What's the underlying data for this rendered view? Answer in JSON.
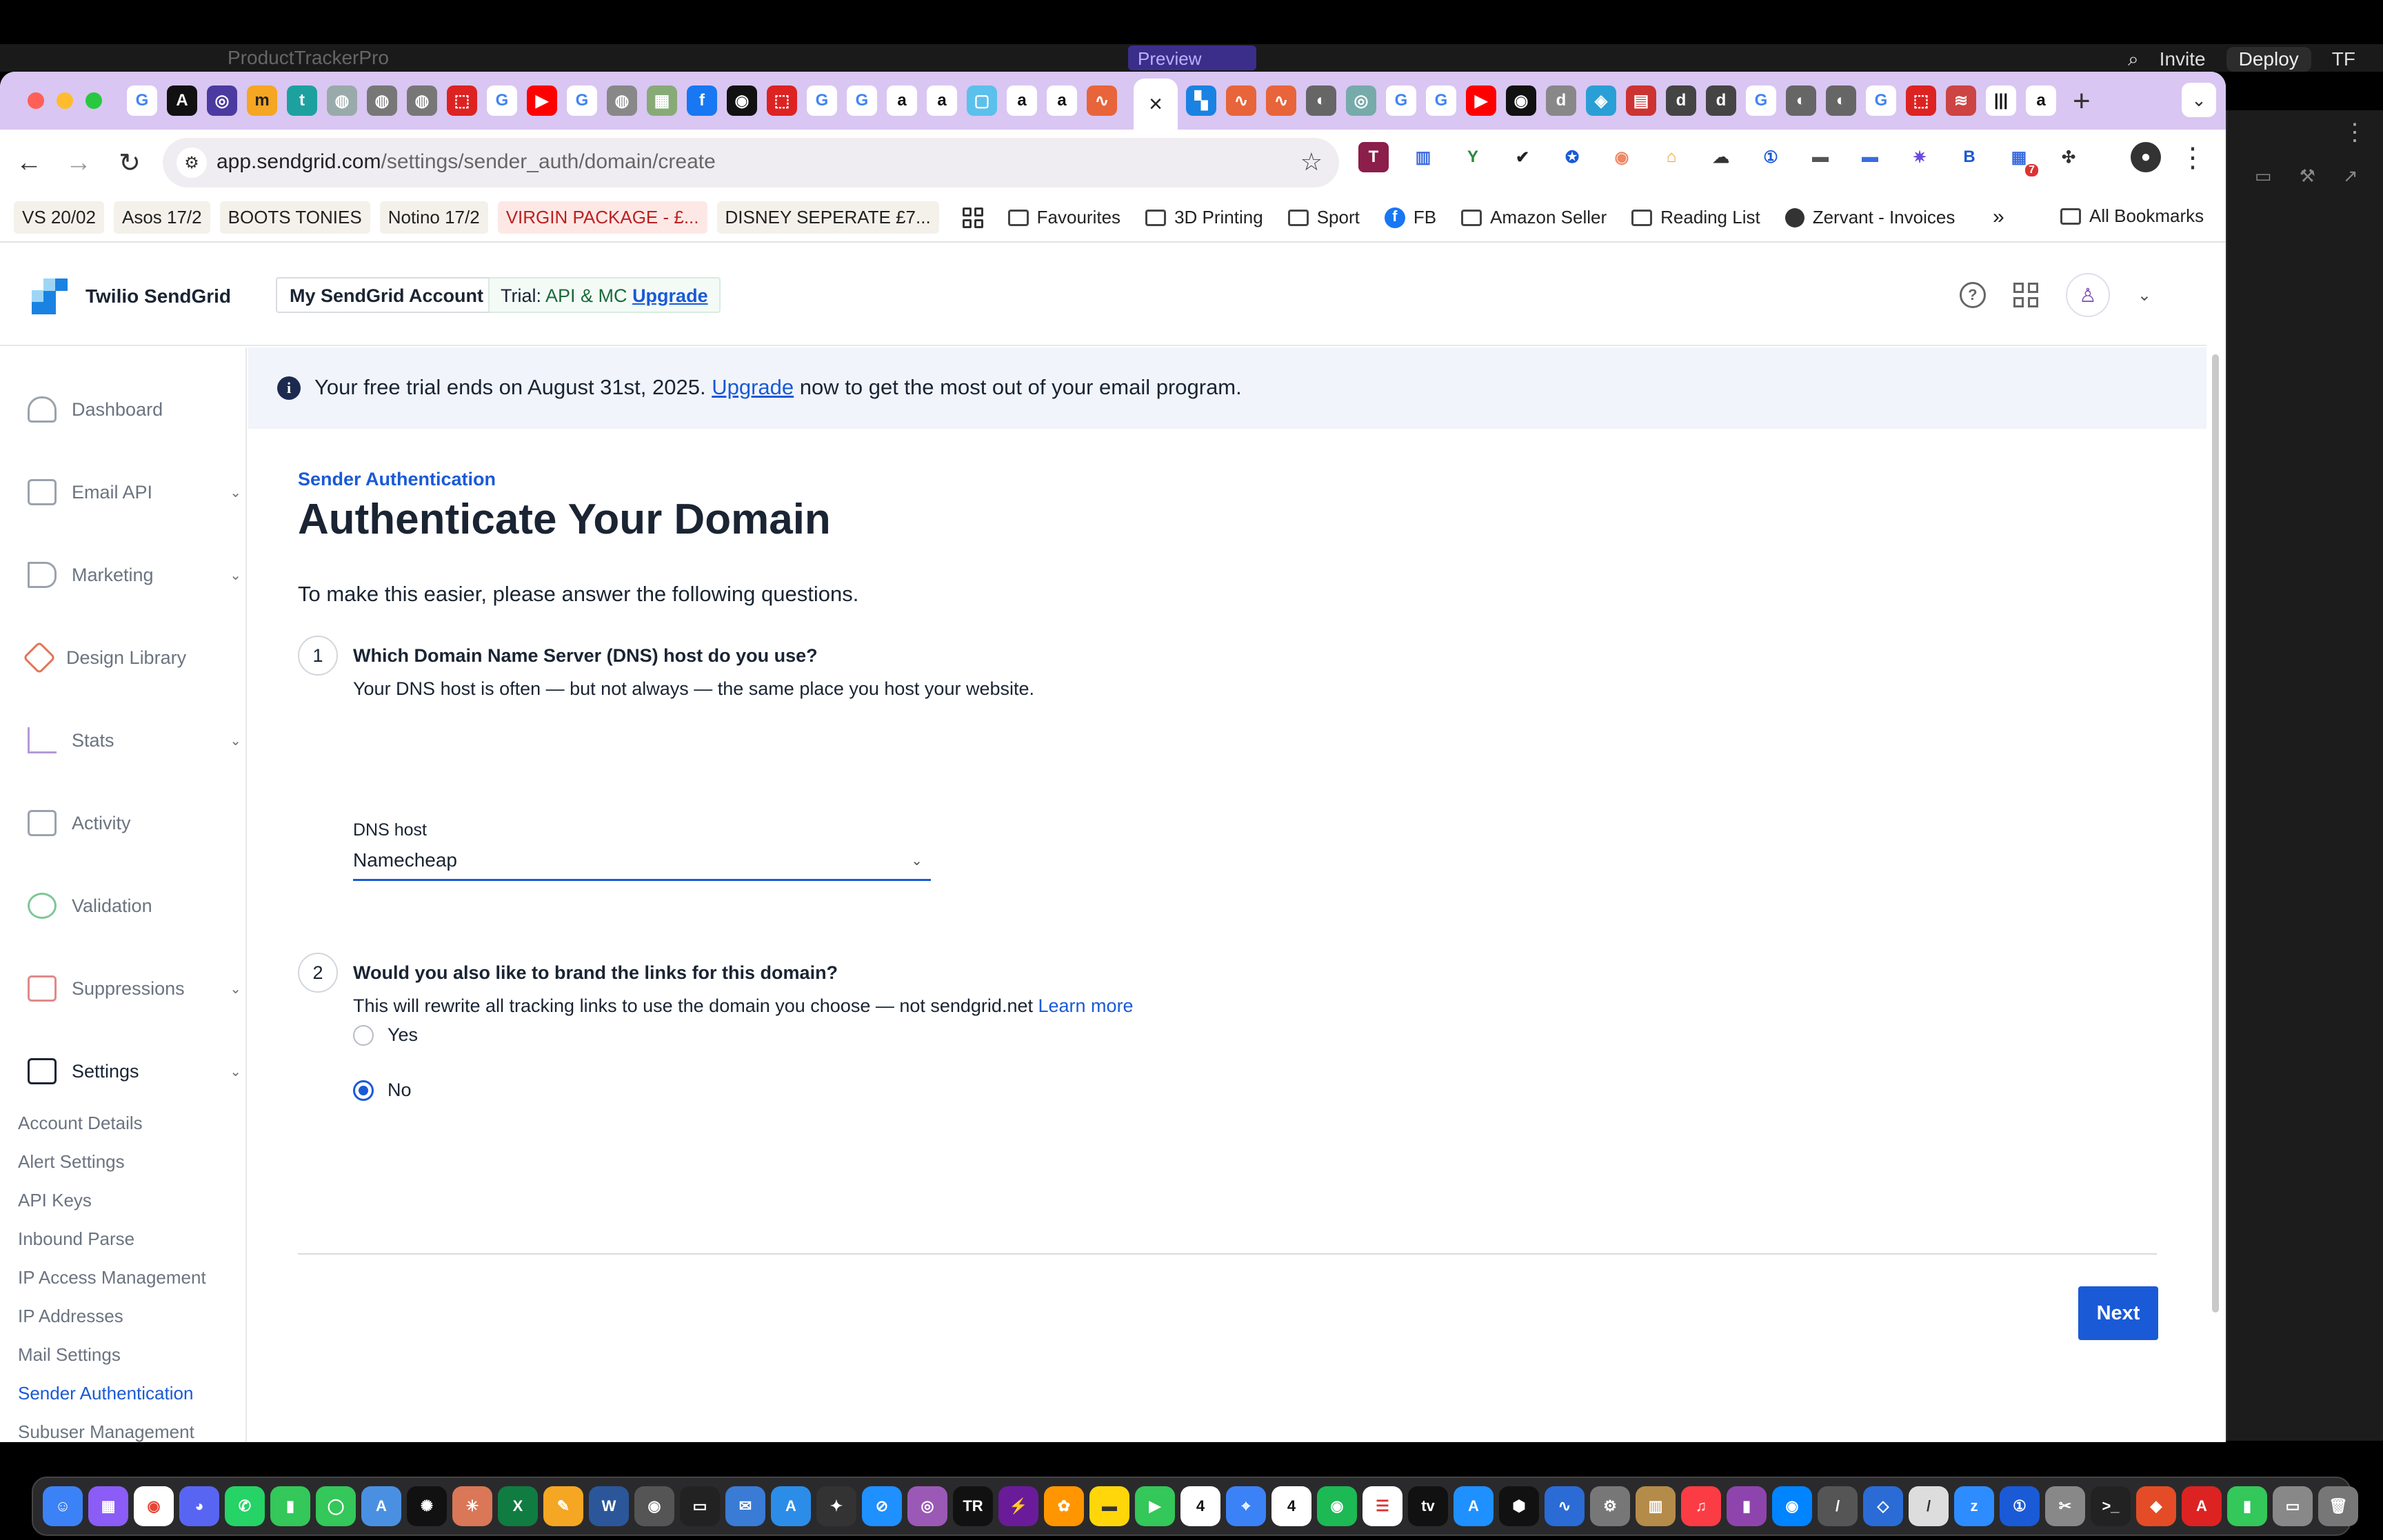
{
  "background_window": {
    "title": "ProductTrackerPro",
    "tab_label": "Preview",
    "invite_label": "Invite",
    "deploy_label": "Deploy",
    "user_initials": "TF"
  },
  "browser": {
    "close_tab_glyph": "×",
    "new_tab_glyph": "+",
    "url_host": "app.sendgrid.com",
    "url_path": "/settings/sender_auth/domain/create",
    "extension_badge": "7",
    "bookmarks": [
      {
        "label": "VS 20/02",
        "style": "chip"
      },
      {
        "label": "Asos 17/2",
        "style": "chip"
      },
      {
        "label": "BOOTS TONIES",
        "style": "chip"
      },
      {
        "label": "Notino 17/2",
        "style": "chip"
      },
      {
        "label": "VIRGIN PACKAGE - £...",
        "style": "red"
      },
      {
        "label": "DISNEY SEPERATE £7...",
        "style": "chip"
      }
    ],
    "bookmark_folders": [
      "Favourites",
      "3D Printing",
      "Sport",
      "FB",
      "Amazon Seller",
      "Reading List",
      "Zervant - Invoices"
    ],
    "bookmarks_more": "»",
    "all_bookmarks": "All Bookmarks"
  },
  "header": {
    "brand": "Twilio SendGrid",
    "account_button": "My SendGrid Account",
    "trial_prefix": "Trial:",
    "trial_plan": "API & MC",
    "upgrade_link": "Upgrade",
    "help_glyph": "?"
  },
  "sidebar": {
    "items": [
      {
        "label": "Dashboard",
        "icon": "dashboard-icon",
        "chevron": ""
      },
      {
        "label": "Email API",
        "icon": "email-api-icon",
        "chevron": "⌄"
      },
      {
        "label": "Marketing",
        "icon": "megaphone-icon",
        "chevron": "⌄"
      },
      {
        "label": "Design Library",
        "icon": "design-icon",
        "chevron": ""
      },
      {
        "label": "Stats",
        "icon": "stats-icon",
        "chevron": "⌄"
      },
      {
        "label": "Activity",
        "icon": "activity-icon",
        "chevron": ""
      },
      {
        "label": "Validation",
        "icon": "validation-icon",
        "chevron": ""
      },
      {
        "label": "Suppressions",
        "icon": "suppressions-icon",
        "chevron": "⌄"
      },
      {
        "label": "Settings",
        "icon": "settings-icon",
        "chevron": "⌄"
      }
    ],
    "settings_subitems": [
      "Account Details",
      "Alert Settings",
      "API Keys",
      "Inbound Parse",
      "IP Access Management",
      "IP Addresses",
      "Mail Settings",
      "Sender Authentication",
      "Subuser Management"
    ]
  },
  "banner": {
    "text_before": "Your free trial ends on August 31st, 2025.",
    "link": "Upgrade",
    "text_after": "now to get the most out of your email program."
  },
  "main": {
    "eyebrow": "Sender Authentication",
    "title": "Authenticate Your Domain",
    "intro": "To make this easier, please answer the following questions.",
    "q1": {
      "number": "1",
      "title": "Which Domain Name Server (DNS) host do you use?",
      "subtitle": "Your DNS host is often — but not always — the same place you host your website.",
      "field_label": "DNS host",
      "field_value": "Namecheap"
    },
    "q2": {
      "number": "2",
      "title": "Would you also like to brand the links for this domain?",
      "subtitle": "This will rewrite all tracking links to use the domain you choose — not sendgrid.net",
      "learn_more": "Learn more",
      "options": [
        {
          "label": "Yes",
          "selected": false
        },
        {
          "label": "No",
          "selected": true
        }
      ]
    },
    "next_button": "Next"
  },
  "colors": {
    "accent": "#1a5ad6",
    "text": "#1a2433",
    "tabstrip": "#d9c6f2",
    "banner_bg": "#f1f4fa"
  }
}
